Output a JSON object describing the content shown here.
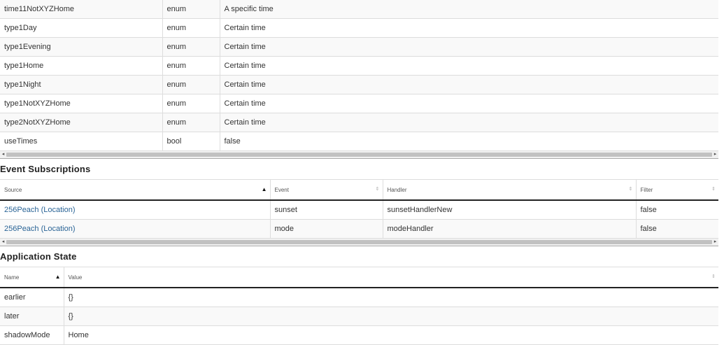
{
  "settings": {
    "rows": [
      {
        "name": "time11NotXYZHome",
        "type": "enum",
        "value": "A specific time"
      },
      {
        "name": "type1Day",
        "type": "enum",
        "value": "Certain time"
      },
      {
        "name": "type1Evening",
        "type": "enum",
        "value": "Certain time"
      },
      {
        "name": "type1Home",
        "type": "enum",
        "value": "Certain time"
      },
      {
        "name": "type1Night",
        "type": "enum",
        "value": "Certain time"
      },
      {
        "name": "type1NotXYZHome",
        "type": "enum",
        "value": "Certain time"
      },
      {
        "name": "type2NotXYZHome",
        "type": "enum",
        "value": "Certain time"
      },
      {
        "name": "useTimes",
        "type": "bool",
        "value": "false"
      }
    ]
  },
  "event_subscriptions": {
    "title": "Event Subscriptions",
    "headers": {
      "source": "Source",
      "event": "Event",
      "handler": "Handler",
      "filter": "Filter"
    },
    "rows": [
      {
        "source": "256Peach (Location)",
        "event": "sunset",
        "handler": "sunsetHandlerNew",
        "filter": "false"
      },
      {
        "source": "256Peach (Location)",
        "event": "mode",
        "handler": "modeHandler",
        "filter": "false"
      }
    ]
  },
  "application_state": {
    "title": "Application State",
    "headers": {
      "name": "Name",
      "value": "Value"
    },
    "rows": [
      {
        "name": "earlier",
        "value": "{}"
      },
      {
        "name": "later",
        "value": "{}"
      },
      {
        "name": "shadowMode",
        "value": "Home"
      }
    ]
  },
  "icons": {
    "scroll_left": "◂",
    "scroll_right": "▸",
    "sort_asc": "▲",
    "sort_both": "⇕"
  },
  "colors": {
    "link": "#2a6496",
    "row_alt": "#f9f9f9",
    "border": "#dddddd"
  }
}
